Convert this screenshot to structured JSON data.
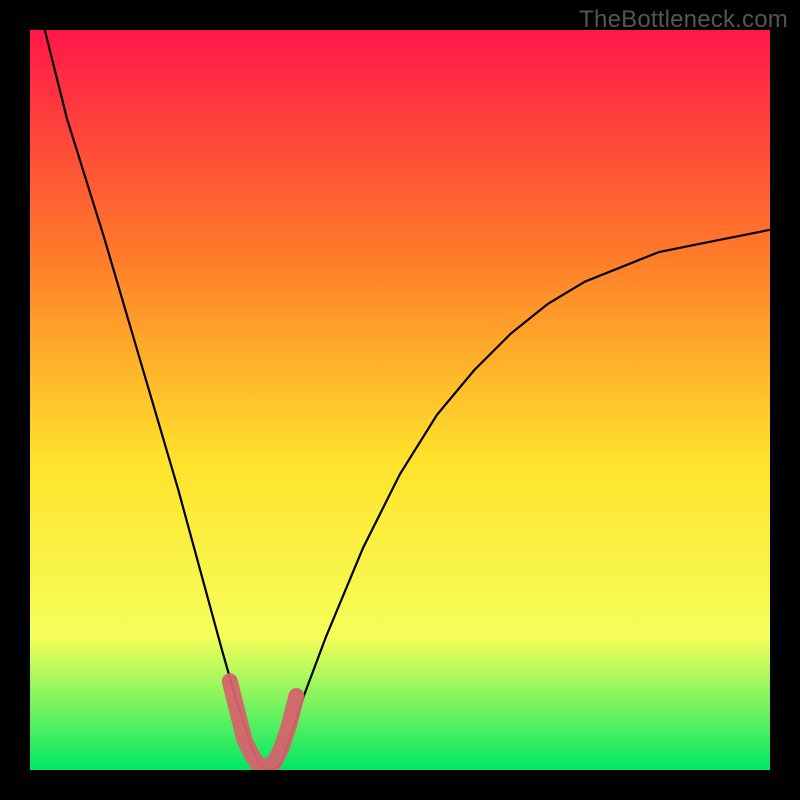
{
  "watermark": "TheBottleneck.com",
  "chart_data": {
    "type": "line",
    "title": "",
    "xlabel": "",
    "ylabel": "",
    "xlim": [
      0,
      100
    ],
    "ylim": [
      0,
      100
    ],
    "grid": false,
    "legend": false,
    "gradient_colors": {
      "top": "#ff1749",
      "mid_upper": "#ff7a2a",
      "mid": "#ffe22b",
      "mid_lower": "#f5ff5a",
      "bottom": "#00e864"
    },
    "series": [
      {
        "name": "bottleneck-curve",
        "note": "black V-shaped curve; y is bottleneck % (0 at minimum)",
        "x": [
          2,
          5,
          10,
          15,
          20,
          23,
          26,
          28,
          30,
          31,
          32,
          33,
          34,
          35,
          37,
          40,
          45,
          50,
          55,
          60,
          65,
          70,
          75,
          80,
          85,
          90,
          95,
          100
        ],
        "y": [
          100,
          88,
          72,
          55,
          38,
          27,
          16,
          9,
          3,
          1,
          0,
          0,
          1,
          4,
          10,
          18,
          30,
          40,
          48,
          54,
          59,
          63,
          66,
          68,
          70,
          71,
          72,
          73
        ]
      },
      {
        "name": "highlight-band",
        "note": "thick salmon overlay around minimum of curve",
        "x": [
          27,
          28,
          29,
          30,
          31,
          32,
          33,
          34,
          35,
          36
        ],
        "y": [
          12,
          8,
          4,
          2,
          0.5,
          0.5,
          1,
          3,
          6,
          10
        ]
      }
    ]
  }
}
